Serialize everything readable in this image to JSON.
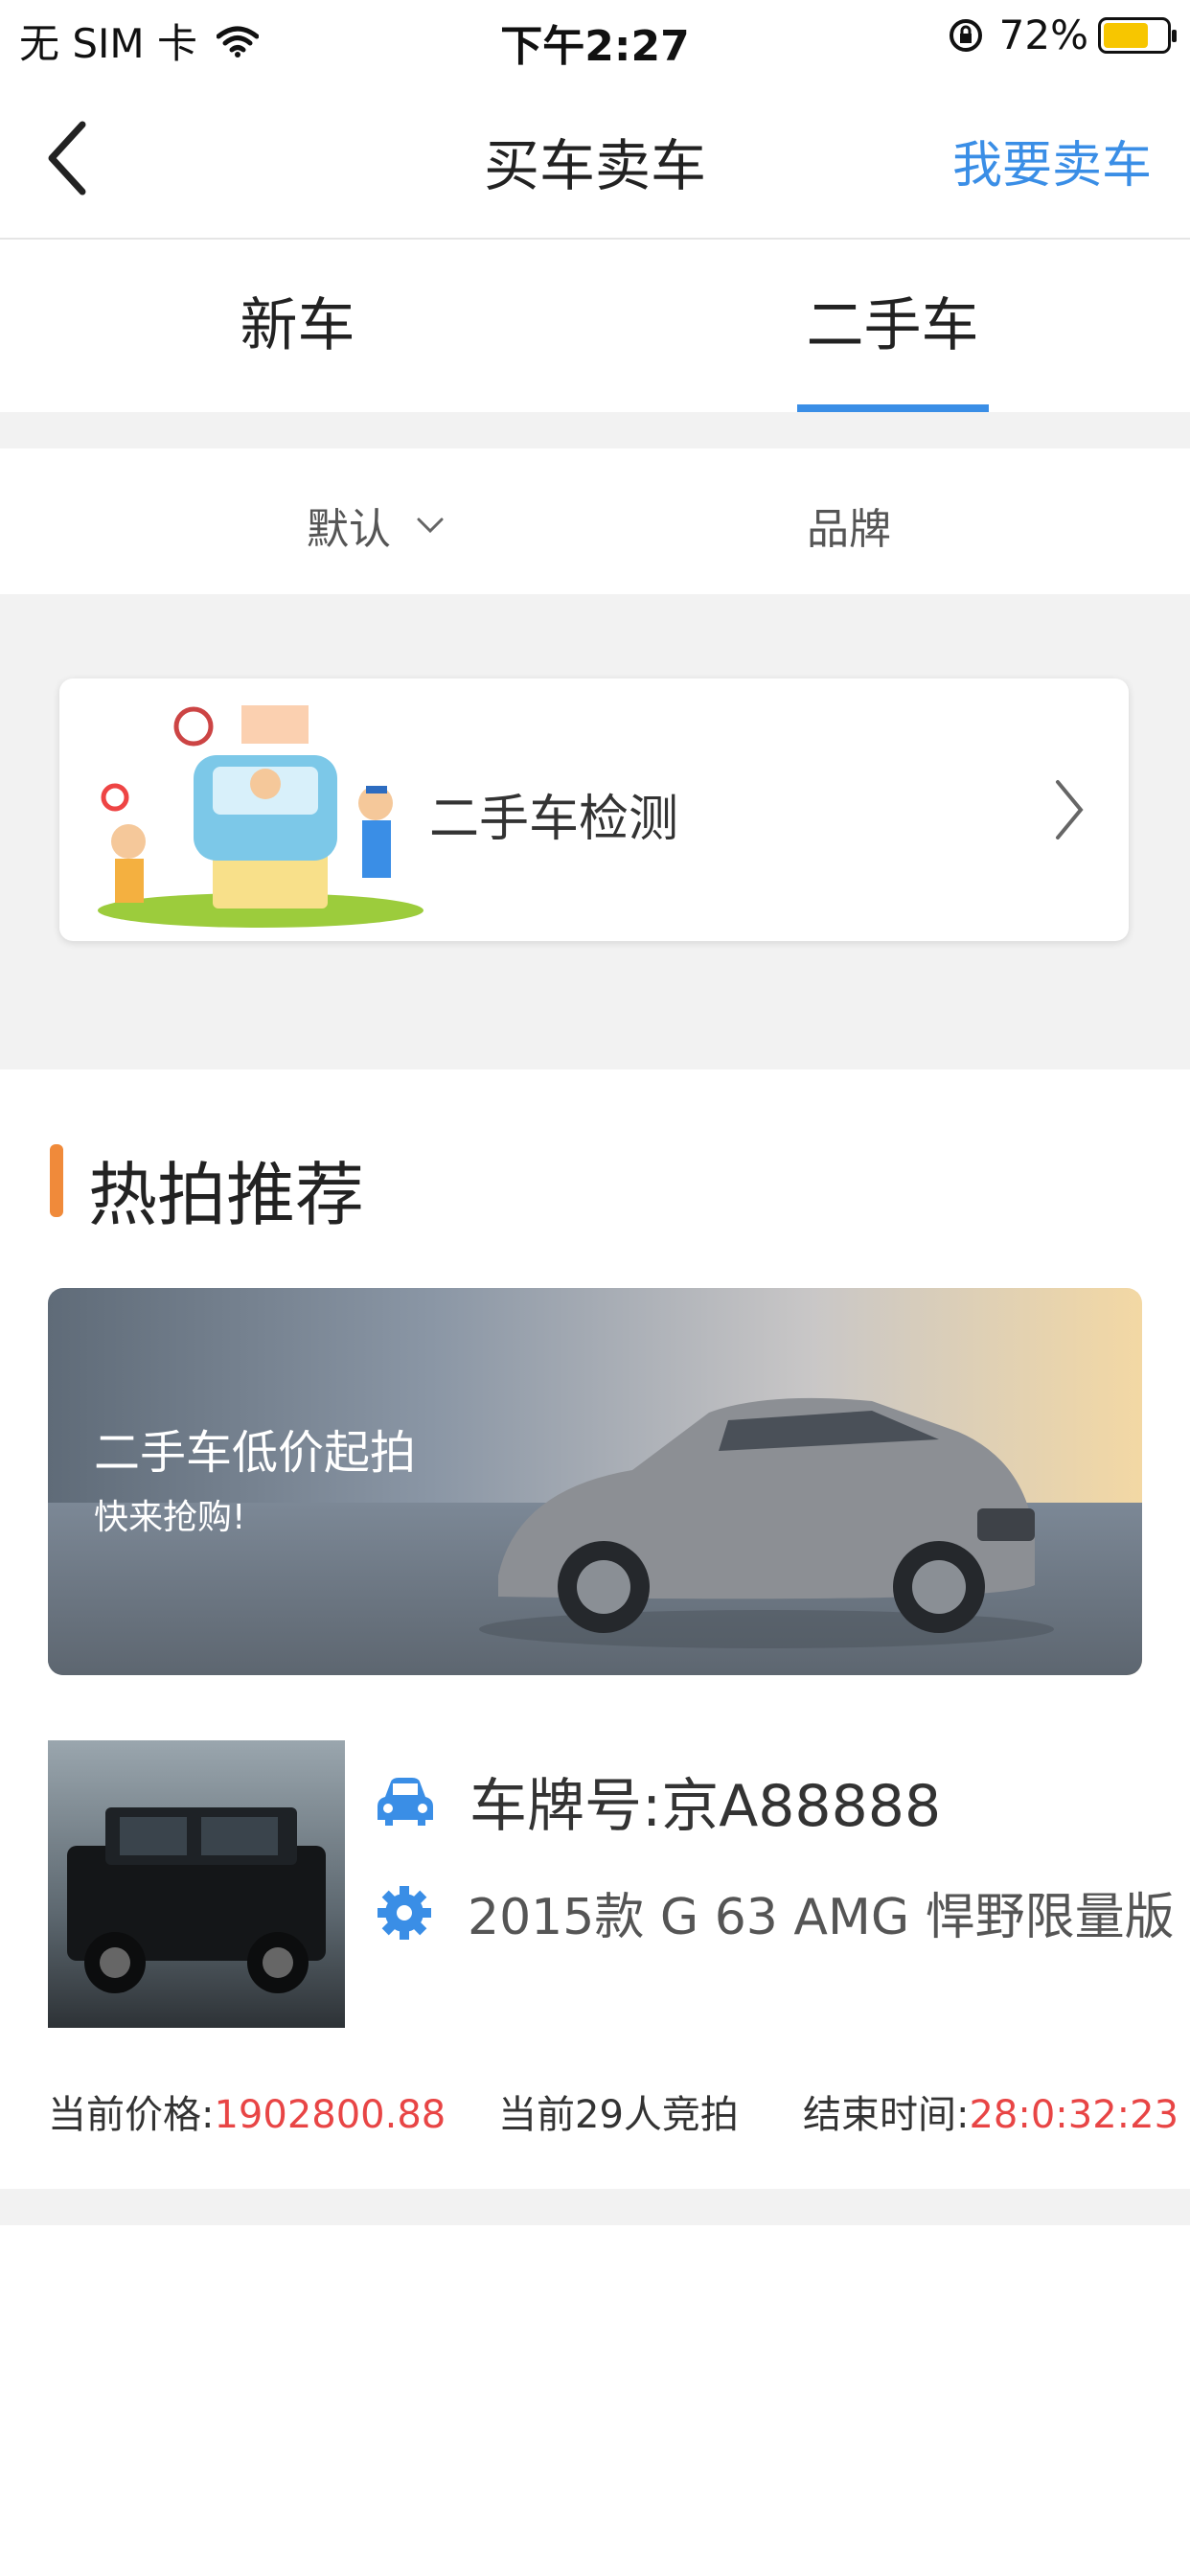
{
  "status_bar": {
    "carrier": "无 SIM 卡",
    "time": "下午2:27",
    "battery_percent": "72%",
    "battery_level": 0.72
  },
  "nav": {
    "title": "买车卖车",
    "right_action": "我要卖车"
  },
  "tabs": [
    {
      "label": "新车",
      "active": false
    },
    {
      "label": "二手车",
      "active": true
    }
  ],
  "filters": {
    "sort_label": "默认",
    "brand_label": "品牌"
  },
  "inspection": {
    "label": "二手车检测"
  },
  "hot": {
    "title": "热拍推荐",
    "banner_title": "二手车低价起拍",
    "banner_subtitle": "快来抢购!",
    "listing": {
      "plate": "车牌号:京A88888",
      "model": "2015款 G 63 AMG 悍野限量版",
      "price_label": "当前价格:",
      "price_value": "1902800.88",
      "bidders": "当前29人竞拍",
      "end_label": "结束时间:",
      "end_value": "28:0:32:23"
    }
  },
  "colors": {
    "accent": "#3a8ee6",
    "highlight": "#e84545",
    "section_marker": "#f08a3a"
  }
}
